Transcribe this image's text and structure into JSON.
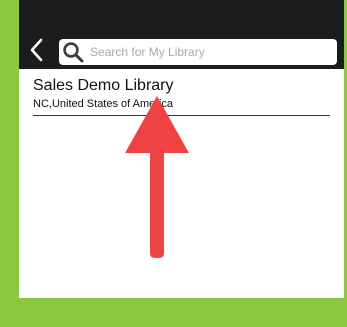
{
  "search": {
    "placeholder": "Search for My Library",
    "value": ""
  },
  "results": [
    {
      "title": "Sales Demo Library",
      "subtitle": "NC,United States of America"
    }
  ],
  "colors": {
    "background_accent": "#8dc63f",
    "toolbar": "#1b1c1e",
    "arrow": "#ef4343"
  },
  "icons": {
    "back": "chevron-left-icon",
    "search": "search-icon",
    "annotation": "arrow-up-icon"
  }
}
